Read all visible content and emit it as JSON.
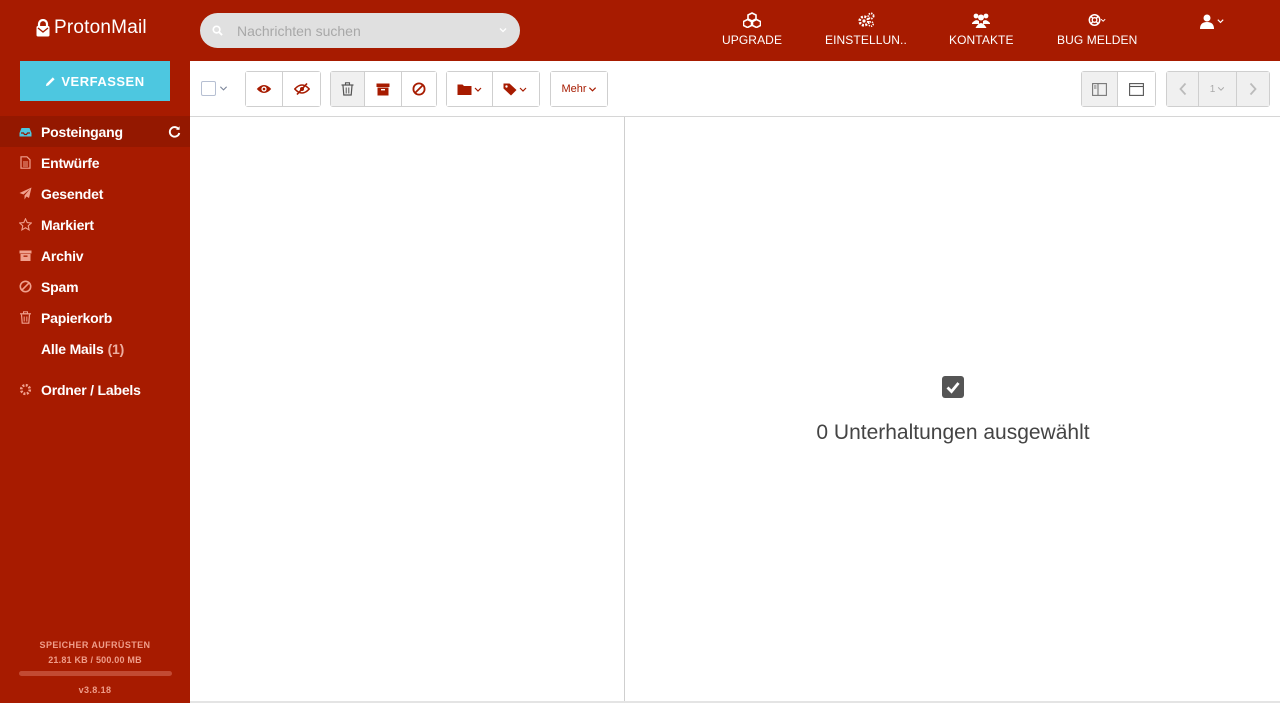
{
  "app": {
    "name": "ProtonMail"
  },
  "search": {
    "placeholder": "Nachrichten suchen"
  },
  "topnav": [
    {
      "label": "UPGRADE",
      "icon": "cubes-icon"
    },
    {
      "label": "EINSTELLUN..",
      "icon": "gears-icon"
    },
    {
      "label": "KONTAKTE",
      "icon": "users-icon"
    },
    {
      "label": "BUG MELDEN",
      "icon": "lifebuoy-icon"
    }
  ],
  "compose": {
    "label": "VERFASSEN"
  },
  "sidebar": {
    "items": [
      {
        "label": "Posteingang",
        "icon": "inbox-icon",
        "active": true
      },
      {
        "label": "Entwürfe",
        "icon": "file-icon"
      },
      {
        "label": "Gesendet",
        "icon": "paper-plane-icon"
      },
      {
        "label": "Markiert",
        "icon": "star-icon"
      },
      {
        "label": "Archiv",
        "icon": "archive-icon"
      },
      {
        "label": "Spam",
        "icon": "ban-icon"
      },
      {
        "label": "Papierkorb",
        "icon": "trash-icon"
      },
      {
        "label": "Alle Mails",
        "count": "(1)"
      },
      {
        "label": "Ordner / Labels",
        "icon": "gear-icon"
      }
    ]
  },
  "storage": {
    "title": "SPEICHER AUFRÜSTEN",
    "usage": "21.81 KB / 500.00 MB",
    "fraction": 4e-05,
    "version": "v3.8.18"
  },
  "toolbar": {
    "more_label": "Mehr",
    "page": "1"
  },
  "reader": {
    "selected_text": "0 Unterhaltungen ausgewählt"
  },
  "colors": {
    "brand": "#a71b00",
    "compose": "#4dc7e0"
  }
}
